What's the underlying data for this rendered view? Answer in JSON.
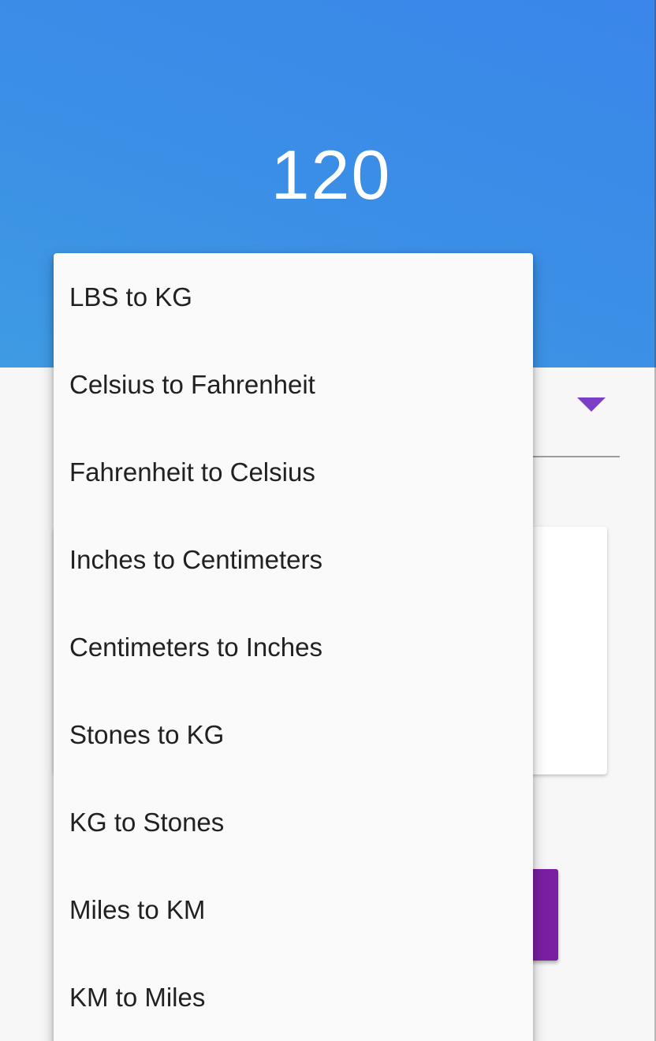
{
  "result": {
    "value": "120"
  },
  "colors": {
    "header_blue": "#3b8fe6",
    "accent_purple": "#7b3fc6",
    "button_purple": "#7b1fa2",
    "menu_background": "#fafafa"
  },
  "icons": {
    "spinner_arrow": "dropdown-arrow-icon"
  },
  "dropdown": {
    "options": [
      "LBS to KG",
      "Celsius to Fahrenheit",
      "Fahrenheit to Celsius",
      "Inches to Centimeters",
      "Centimeters to Inches",
      "Stones to KG",
      "KG to Stones",
      "Miles to KM",
      "KM to Miles"
    ]
  }
}
